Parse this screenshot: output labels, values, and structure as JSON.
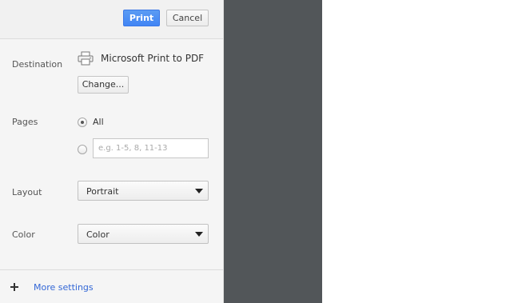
{
  "header": {
    "print_label": "Print",
    "cancel_label": "Cancel"
  },
  "destination": {
    "label": "Destination",
    "printer_name": "Microsoft Print to PDF",
    "printer_icon": "printer-icon",
    "change_label": "Change..."
  },
  "pages": {
    "label": "Pages",
    "all_label": "All",
    "all_selected": true,
    "custom_placeholder": "e.g. 1-5, 8, 11-13",
    "custom_value": ""
  },
  "layout": {
    "label": "Layout",
    "value": "Portrait"
  },
  "color": {
    "label": "Color",
    "value": "Color"
  },
  "footer": {
    "more_settings_label": "More settings",
    "expand_icon": "plus-icon"
  },
  "colors": {
    "primary_button": "#4285f4",
    "link": "#3367d6",
    "preview_background": "#525659",
    "sidebar_background": "#f5f5f5"
  }
}
